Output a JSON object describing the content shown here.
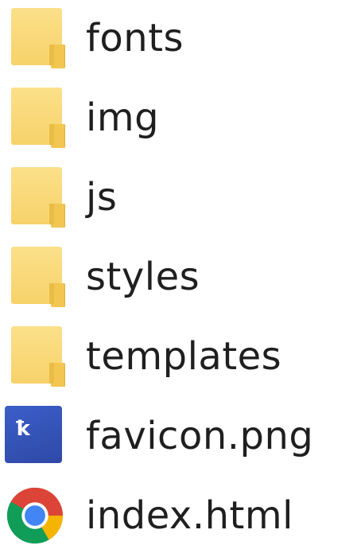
{
  "items": [
    {
      "name": "fonts",
      "type": "folder",
      "icon": "folder-icon"
    },
    {
      "name": "img",
      "type": "folder",
      "icon": "folder-icon"
    },
    {
      "name": "js",
      "type": "folder",
      "icon": "folder-icon"
    },
    {
      "name": "styles",
      "type": "folder",
      "icon": "folder-icon"
    },
    {
      "name": "templates",
      "type": "folder",
      "icon": "folder-icon"
    },
    {
      "name": "favicon.png",
      "type": "image",
      "icon": "image-file-icon"
    },
    {
      "name": "index.html",
      "type": "html",
      "icon": "chrome-icon"
    }
  ],
  "colors": {
    "folder": "#f7d26a",
    "png_icon": "#3552b8",
    "text": "#1f1f1f"
  }
}
